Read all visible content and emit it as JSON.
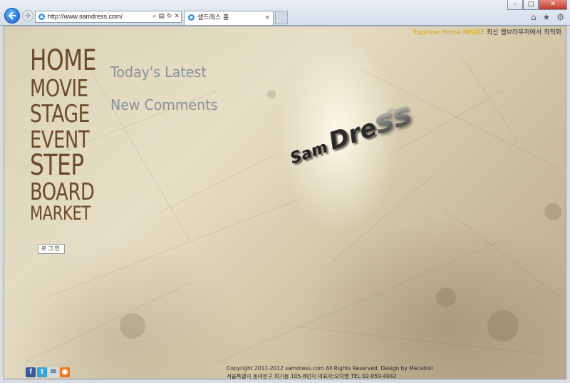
{
  "browser": {
    "url": "http://www.samdress.com/",
    "tab_title": "샘드레스 홈",
    "tab_close": "×",
    "window_controls": {
      "minimize": "–",
      "maximize": "□",
      "close": "✕"
    },
    "icons": [
      "back-arrow-icon",
      "forward-arrow-icon",
      "ie-logo-icon",
      "search-icon",
      "compat-icon",
      "refresh-icon",
      "stop-icon",
      "home-icon",
      "favorites-star-icon",
      "gear-icon"
    ]
  },
  "page": {
    "top_note": {
      "warning": "Explorer Home INSIDE",
      "text": "최신 웹브라우저에서 최적화"
    },
    "menu": [
      "HOME",
      "MOVIE",
      "STAGE",
      "EVENT",
      "STEP",
      "BOARD",
      "MARKET"
    ],
    "login_label": "로그인",
    "headlines": [
      "Today's Latest",
      "New Comments"
    ],
    "logo": {
      "part1": "Sam",
      "part2": "Dre",
      "part3": "ss"
    },
    "footer": {
      "line1": "Copyright 2011-2012 samdress.com All Rights Reserved.    Design by Mecaboil",
      "line2": "서울특별시 동대문구 회기동 105-8번지   대표자:오덕영    TEL 02-959-4042"
    },
    "social": [
      {
        "name": "facebook-icon",
        "glyph": "f"
      },
      {
        "name": "twitter-icon",
        "glyph": "t"
      },
      {
        "name": "mail-icon",
        "glyph": "✉"
      },
      {
        "name": "rss-icon",
        "glyph": "◉"
      }
    ]
  }
}
